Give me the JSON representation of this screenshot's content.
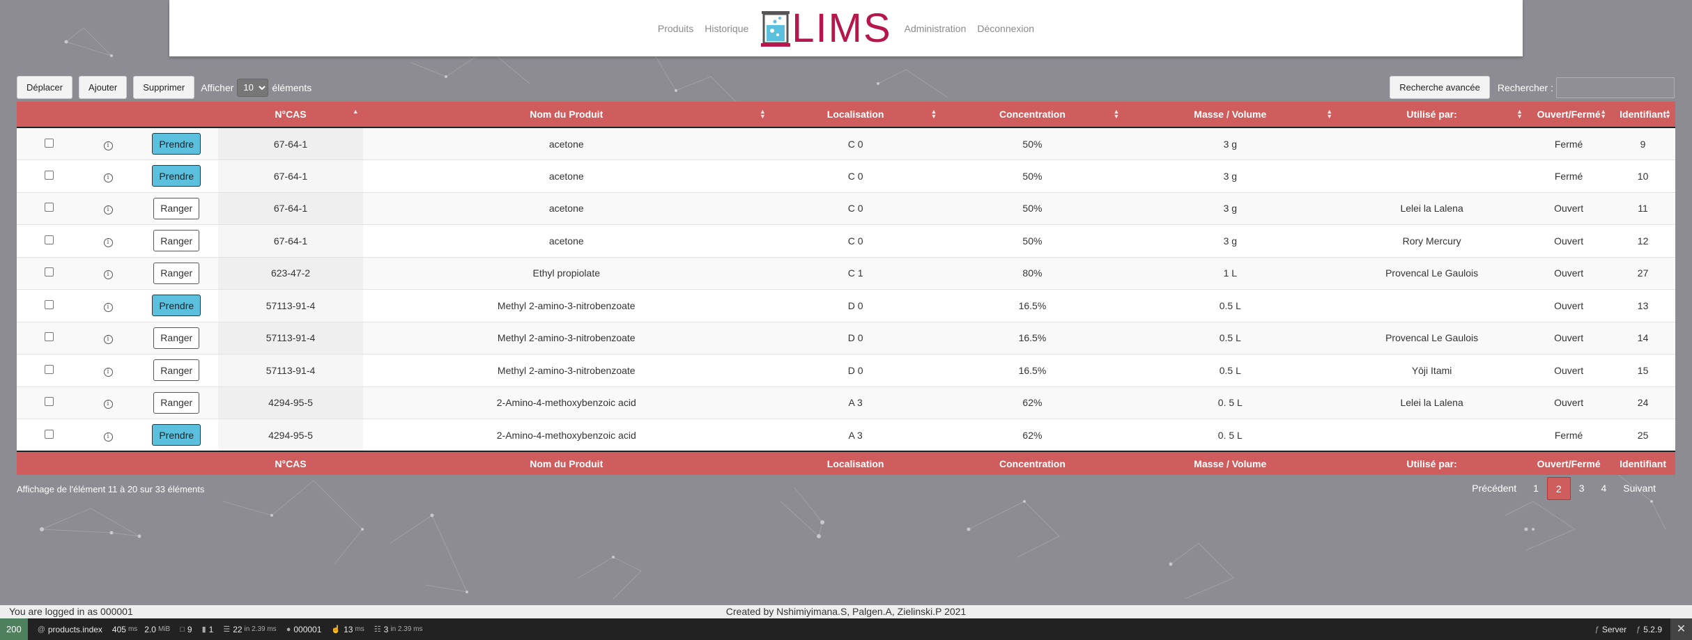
{
  "header": {
    "nav_left": [
      "Produits",
      "Historique"
    ],
    "logo_text": "LIMS",
    "nav_right": [
      "Administration",
      "Déconnexion"
    ],
    "brand_color": "#b5174d"
  },
  "toolbar": {
    "move_label": "Déplacer",
    "add_label": "Ajouter",
    "delete_label": "Supprimer",
    "show_prefix": "Afficher",
    "page_size": "10",
    "show_suffix": "éléments",
    "advanced_search_label": "Recherche avancée",
    "search_label": "Rechercher :",
    "search_value": ""
  },
  "table": {
    "columns": [
      "",
      "",
      "",
      "N°CAS",
      "Nom du Produit",
      "Localisation",
      "Concentration",
      "Masse / Volume",
      "Utilisé par:",
      "Ouvert/Fermé",
      "Identifiant"
    ],
    "header_color": "#d05d5d",
    "rows": [
      {
        "action": "Prendre",
        "cas": "67-64-1",
        "name": "acetone",
        "loc": "C 0",
        "conc": "50%",
        "mass": "3 g",
        "user": "",
        "state": "Fermé",
        "id": "9"
      },
      {
        "action": "Prendre",
        "cas": "67-64-1",
        "name": "acetone",
        "loc": "C 0",
        "conc": "50%",
        "mass": "3 g",
        "user": "",
        "state": "Fermé",
        "id": "10"
      },
      {
        "action": "Ranger",
        "cas": "67-64-1",
        "name": "acetone",
        "loc": "C 0",
        "conc": "50%",
        "mass": "3 g",
        "user": "Lelei la Lalena",
        "state": "Ouvert",
        "id": "11"
      },
      {
        "action": "Ranger",
        "cas": "67-64-1",
        "name": "acetone",
        "loc": "C 0",
        "conc": "50%",
        "mass": "3 g",
        "user": "Rory Mercury",
        "state": "Ouvert",
        "id": "12"
      },
      {
        "action": "Ranger",
        "cas": "623-47-2",
        "name": "Ethyl propiolate",
        "loc": "C 1",
        "conc": "80%",
        "mass": "1 L",
        "user": "Provencal Le Gaulois",
        "state": "Ouvert",
        "id": "27"
      },
      {
        "action": "Prendre",
        "cas": "57113-91-4",
        "name": "Methyl 2-amino-3-nitrobenzoate",
        "loc": "D 0",
        "conc": "16.5%",
        "mass": "0.5 L",
        "user": "",
        "state": "Ouvert",
        "id": "13"
      },
      {
        "action": "Ranger",
        "cas": "57113-91-4",
        "name": "Methyl 2-amino-3-nitrobenzoate",
        "loc": "D 0",
        "conc": "16.5%",
        "mass": "0.5 L",
        "user": "Provencal Le Gaulois",
        "state": "Ouvert",
        "id": "14"
      },
      {
        "action": "Ranger",
        "cas": "57113-91-4",
        "name": "Methyl 2-amino-3-nitrobenzoate",
        "loc": "D 0",
        "conc": "16.5%",
        "mass": "0.5 L",
        "user": "Yōji Itami",
        "state": "Ouvert",
        "id": "15"
      },
      {
        "action": "Ranger",
        "cas": "4294-95-5",
        "name": "2-Amino-4-methoxybenzoic acid",
        "loc": "A 3",
        "conc": "62%",
        "mass": "0. 5 L",
        "user": "Lelei la Lalena",
        "state": "Ouvert",
        "id": "24"
      },
      {
        "action": "Prendre",
        "cas": "4294-95-5",
        "name": "2-Amino-4-methoxybenzoic acid",
        "loc": "A 3",
        "conc": "62%",
        "mass": "0. 5 L",
        "user": "",
        "state": "Fermé",
        "id": "25"
      }
    ]
  },
  "pagination": {
    "info": "Affichage de l'élément 11 à 20 sur 33 éléments",
    "previous": "Précédent",
    "pages": [
      "1",
      "2",
      "3",
      "4"
    ],
    "current": "2",
    "next": "Suivant"
  },
  "footer": {
    "logged_in": "You are logged in as 000001",
    "credits": "Created by Nshimiyimana.S, Palgen.A, Zielinski.P 2021"
  },
  "debugbar": {
    "status": "200",
    "route": "products.index",
    "time": "405",
    "time_unit": "ms",
    "memory": "2.0",
    "memory_unit": "MiB",
    "forms": "9",
    "templates_count": "1",
    "cache": "22",
    "cache_detail": "in 2.39 ms",
    "user": "000001",
    "events": "13",
    "events_unit": "ms",
    "db": "3",
    "db_detail": "in 2.39 ms",
    "server_label": "Server",
    "symfony_version": "5.2.9"
  }
}
